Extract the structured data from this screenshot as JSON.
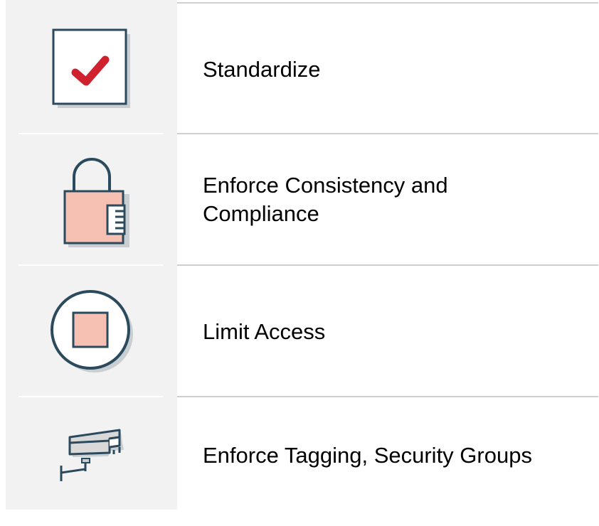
{
  "colors": {
    "icon_column_bg": "#f2f2f2",
    "divider": "#cfcfcf",
    "icon_stroke": "#2b4a5e",
    "icon_fill_pink": "#f6c0b3",
    "check_red": "#d0212f",
    "camera_fill": "#d9d9d9"
  },
  "rows": [
    {
      "label": "Standardize",
      "icon": "checkbox-checked-icon"
    },
    {
      "label": "Enforce Consistency and Compliance",
      "icon": "padlock-icon"
    },
    {
      "label": "Limit Access",
      "icon": "stop-button-icon"
    },
    {
      "label": "Enforce Tagging, Security Groups",
      "icon": "security-camera-icon"
    }
  ]
}
